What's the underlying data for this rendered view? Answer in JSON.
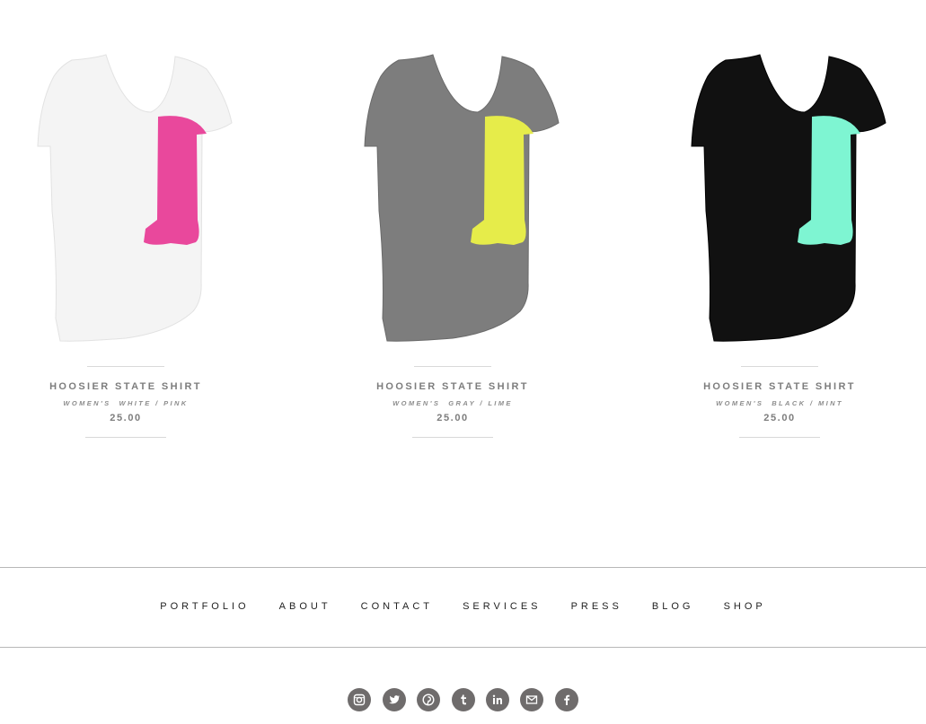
{
  "products": [
    {
      "name": "HOOSIER STATE SHIRT",
      "variant": "WOMEN'S  WHITE / PINK",
      "price": "25.00",
      "shirt_color": "#f4f4f4",
      "print_color": "#e9489c"
    },
    {
      "name": "HOOSIER STATE SHIRT",
      "variant": "WOMEN'S  GRAY / LIME",
      "price": "25.00",
      "shirt_color": "#7d7d7d",
      "print_color": "#e6ec4a"
    },
    {
      "name": "HOOSIER STATE SHIRT",
      "variant": "WOMEN'S  BLACK / MINT",
      "price": "25.00",
      "shirt_color": "#111111",
      "print_color": "#7ef5d2"
    }
  ],
  "nav": {
    "items": [
      "PORTFOLIO",
      "ABOUT",
      "CONTACT",
      "SERVICES",
      "PRESS",
      "BLOG",
      "SHOP"
    ]
  },
  "social": {
    "icons": [
      "instagram-icon",
      "twitter-icon",
      "pinterest-icon",
      "tumblr-icon",
      "linkedin-icon",
      "email-icon",
      "facebook-icon"
    ],
    "icon_bg": "#6f6c6c"
  }
}
